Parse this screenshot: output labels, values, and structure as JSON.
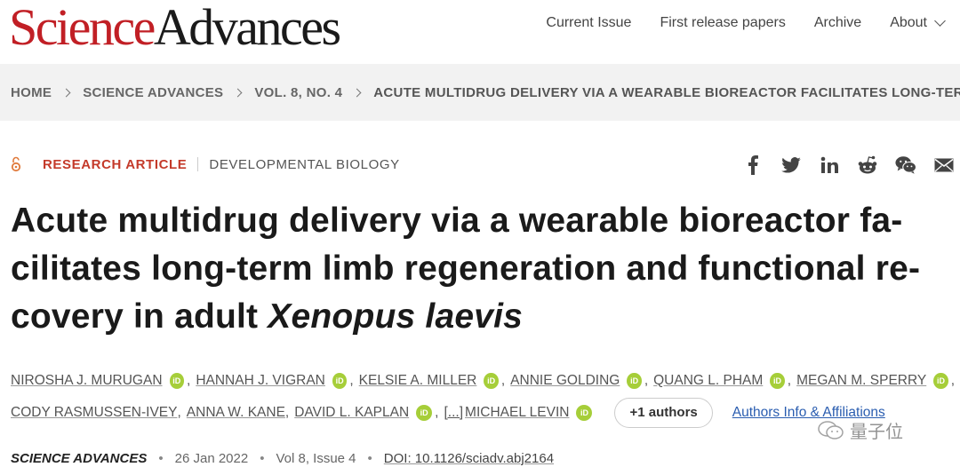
{
  "logo": {
    "science": "Science",
    "advances": "Advances"
  },
  "nav": [
    {
      "label": "Current Issue"
    },
    {
      "label": "First release papers"
    },
    {
      "label": "Archive"
    },
    {
      "label": "About"
    }
  ],
  "breadcrumb": [
    "HOME",
    "SCIENCE ADVANCES",
    "VOL. 8, NO. 4",
    "ACUTE MULTIDRUG DELIVERY VIA A WEARABLE BIOREACTOR FACILITATES LONG-TER..."
  ],
  "article": {
    "type": "RESEARCH ARTICLE",
    "subject": "DEVELOPMENTAL BIOLOGY",
    "title_lines": [
      "Acute multidrug delivery via a wearable bioreactor fa-",
      "cilitates long-term limb regeneration and functional re-",
      "covery in adult "
    ],
    "title_italic": "Xenopus laevis"
  },
  "share_icons": [
    "facebook-icon",
    "twitter-icon",
    "linkedin-icon",
    "reddit-icon",
    "wechat-icon",
    "email-icon"
  ],
  "authors_row1": [
    "NIROSHA J. MURUGAN",
    "HANNAH J. VIGRAN",
    "KELSIE A. MILLER",
    "ANNIE GOLDING",
    "QUANG L. PHAM",
    "MEGAN M. SPERRY"
  ],
  "authors_row2": [
    "CODY RASMUSSEN-IVEY",
    "ANNA W. KANE",
    "DAVID L. KAPLAN"
  ],
  "ellipsis": "[...]",
  "last_author": "MICHAEL LEVIN",
  "orcid_label": "iD",
  "more_authors": "+1 authors",
  "affiliations_link": "Authors Info & Affiliations",
  "meta": {
    "journal": "SCIENCE ADVANCES",
    "date": "26 Jan 2022",
    "issue": "Vol 8, Issue 4",
    "doi": "DOI: 10.1126/sciadv.abj2164",
    "separator": "•"
  },
  "watermark": "量子位",
  "colors": {
    "brand_red": "#c11f25",
    "badge_red": "#c43a2a",
    "orcid_green": "#a6ce39",
    "link_blue": "#2a5db0"
  }
}
